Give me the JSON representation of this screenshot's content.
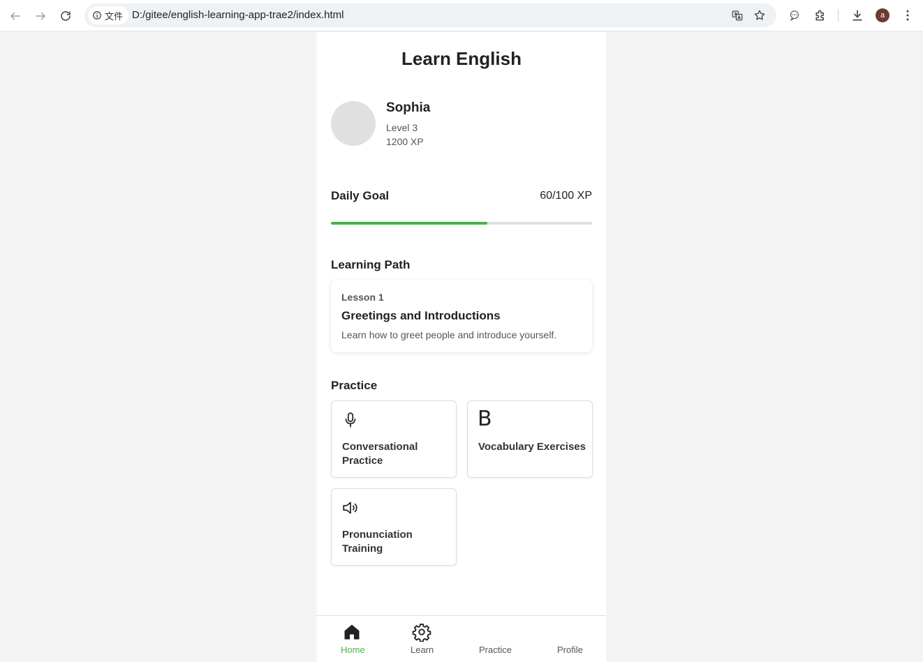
{
  "browser": {
    "site_chip": "文件",
    "url": "D:/gitee/english-learning-app-trae2/index.html",
    "profile_initial": "a"
  },
  "app": {
    "title": "Learn English",
    "profile": {
      "name": "Sophia",
      "level": "Level 3",
      "xp": "1200 XP"
    },
    "daily_goal": {
      "label": "Daily Goal",
      "value_text": "60/100 XP",
      "progress_fraction": 0.6,
      "progress_color": "#4caf50"
    },
    "learning_path": {
      "title": "Learning Path",
      "lesson": {
        "number": "Lesson 1",
        "title": "Greetings and Introductions",
        "description": "Learn how to greet people and introduce yourself."
      }
    },
    "practice": {
      "title": "Practice",
      "items": [
        {
          "label": "Conversational Practice",
          "icon": "microphone-icon"
        },
        {
          "label": "Vocabulary Exercises",
          "icon": "letter-b-icon",
          "glyph": "B"
        },
        {
          "label": "Pronunciation Training",
          "icon": "speaker-icon"
        }
      ]
    },
    "bottom_nav": {
      "active_color": "#4caf50",
      "items": [
        {
          "label": "Home",
          "icon": "home-icon",
          "active": true
        },
        {
          "label": "Learn",
          "icon": "gear-icon",
          "active": false
        },
        {
          "label": "Practice",
          "active": false
        },
        {
          "label": "Profile",
          "active": false
        }
      ]
    }
  }
}
